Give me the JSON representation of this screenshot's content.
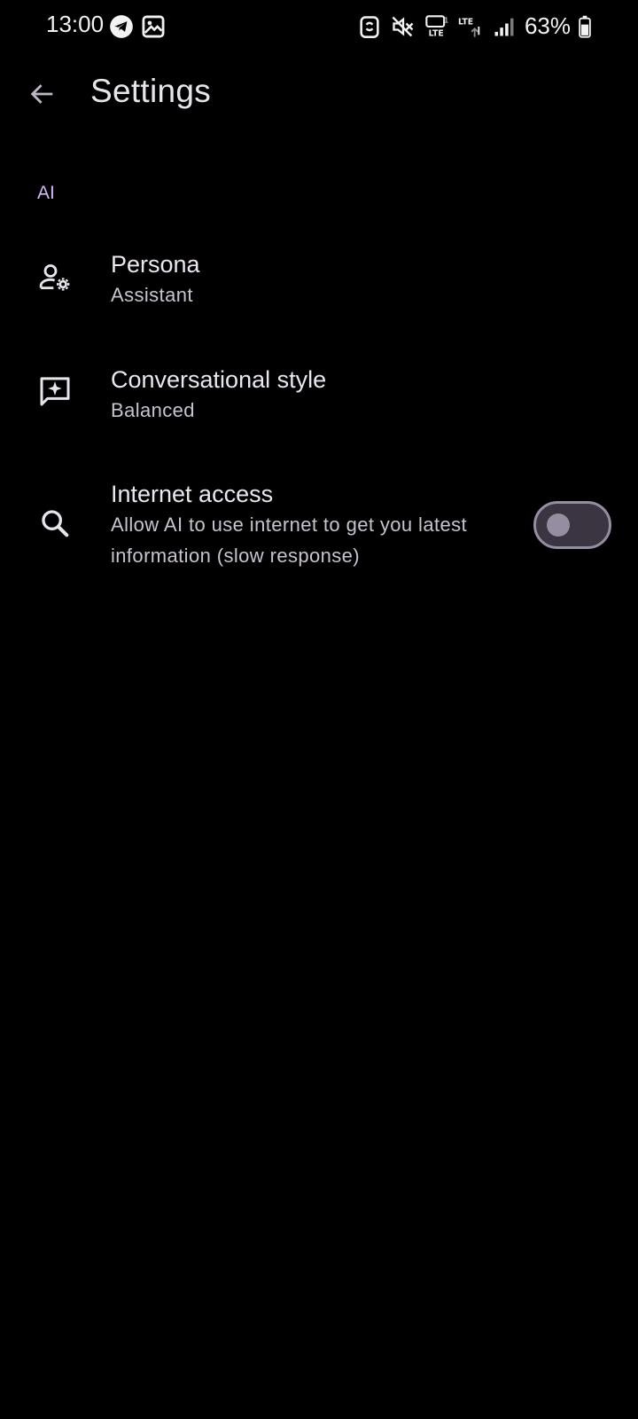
{
  "status_bar": {
    "time": "13:00",
    "battery": "63%",
    "left_icons": [
      "telegram-icon",
      "gallery-icon"
    ],
    "right_icons": [
      "nfc-icon",
      "mute-icon",
      "volte-icon",
      "lte-data-icon",
      "signal-icon",
      "battery-icon"
    ]
  },
  "app_bar": {
    "back_icon": "arrow-back-icon",
    "title": "Settings"
  },
  "section": {
    "header": "AI"
  },
  "settings": [
    {
      "icon": "persona-settings-icon",
      "title": "Persona",
      "subtitle": "Assistant"
    },
    {
      "icon": "chat-sparkle-icon",
      "title": "Conversational style",
      "subtitle": "Balanced"
    },
    {
      "icon": "search-icon",
      "title": "Internet access",
      "subtitle_line1": "Allow AI to use internet to get you latest",
      "subtitle_line2": "information (slow response)",
      "toggle_on": false
    }
  ],
  "colors": {
    "background": "#000000",
    "accent": "#d0b8f0",
    "text_primary": "#ece6f0",
    "text_secondary": "#c9c2cf",
    "toggle_off_track": "#3b3441",
    "toggle_off_border": "#958da0"
  }
}
